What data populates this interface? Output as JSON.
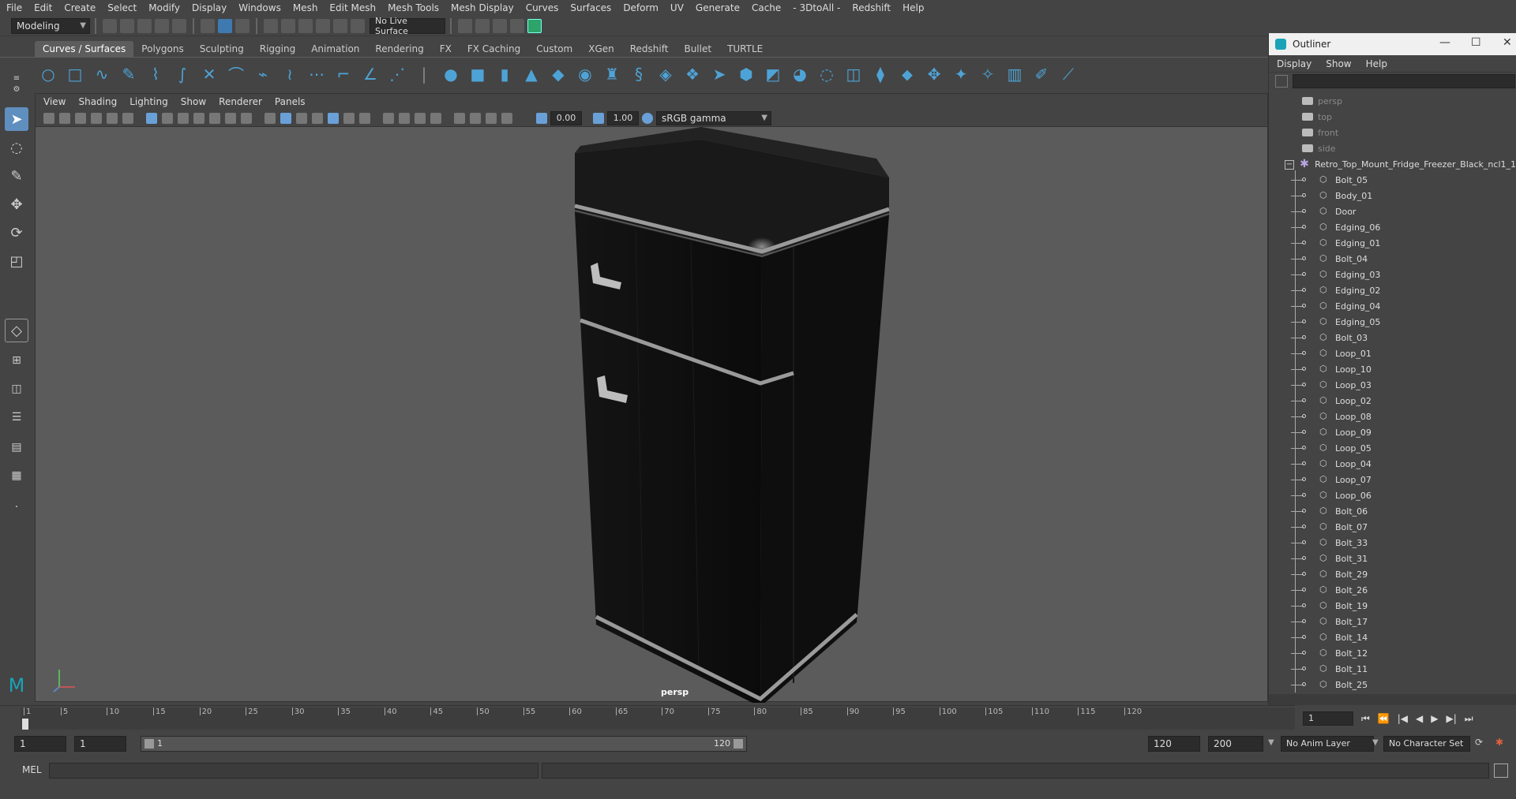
{
  "menubar": {
    "items": [
      "File",
      "Edit",
      "Create",
      "Select",
      "Modify",
      "Display",
      "Windows",
      "Mesh",
      "Edit Mesh",
      "Mesh Tools",
      "Mesh Display",
      "Curves",
      "Surfaces",
      "Deform",
      "UV",
      "Generate",
      "Cache",
      "- 3DtoAll -",
      "Redshift",
      "Help"
    ]
  },
  "statusline": {
    "mode": "Modeling",
    "live_surface": "No Live Surface"
  },
  "shelf": {
    "tabs": [
      "Curves / Surfaces",
      "Polygons",
      "Sculpting",
      "Rigging",
      "Animation",
      "Rendering",
      "FX",
      "FX Caching",
      "Custom",
      "XGen",
      "Redshift",
      "Bullet",
      "TURTLE"
    ],
    "active_tab": "Curves / Surfaces"
  },
  "viewport": {
    "menu": [
      "View",
      "Shading",
      "Lighting",
      "Show",
      "Renderer",
      "Panels"
    ],
    "exposure": "0.00",
    "gamma": "1.00",
    "color_space": "sRGB gamma",
    "camera_label": "persp"
  },
  "outliner": {
    "title": "Outliner",
    "menu": [
      "Display",
      "Show",
      "Help"
    ],
    "cameras": [
      "persp",
      "top",
      "front",
      "side"
    ],
    "root": "Retro_Top_Mount_Fridge_Freezer_Black_ncl1_1",
    "children": [
      "Bolt_05",
      "Body_01",
      "Door",
      "Edging_06",
      "Edging_01",
      "Bolt_04",
      "Edging_03",
      "Edging_02",
      "Edging_04",
      "Edging_05",
      "Bolt_03",
      "Loop_01",
      "Loop_10",
      "Loop_03",
      "Loop_02",
      "Loop_08",
      "Loop_09",
      "Loop_05",
      "Loop_04",
      "Loop_07",
      "Loop_06",
      "Bolt_06",
      "Bolt_07",
      "Bolt_33",
      "Bolt_31",
      "Bolt_29",
      "Bolt_26",
      "Bolt_19",
      "Bolt_17",
      "Bolt_14",
      "Bolt_12",
      "Bolt_11",
      "Bolt_25"
    ]
  },
  "timeline": {
    "ticks": [
      "1",
      "5",
      "10",
      "15",
      "20",
      "25",
      "30",
      "35",
      "40",
      "45",
      "50",
      "55",
      "60",
      "65",
      "70",
      "75",
      "80",
      "85",
      "90",
      "95",
      "100",
      "105",
      "110",
      "115",
      "120"
    ],
    "current_frame": "1"
  },
  "range": {
    "start": "1",
    "playback_start": "1",
    "slider_start": "1",
    "slider_end": "120",
    "playback_end": "120",
    "end": "200",
    "anim_layer": "No Anim Layer",
    "character_set": "No Character Set"
  },
  "cmdline": {
    "label": "MEL"
  },
  "colors": {
    "accent": "#4ea3d6",
    "viewport_bg": "#5b5b5b"
  }
}
